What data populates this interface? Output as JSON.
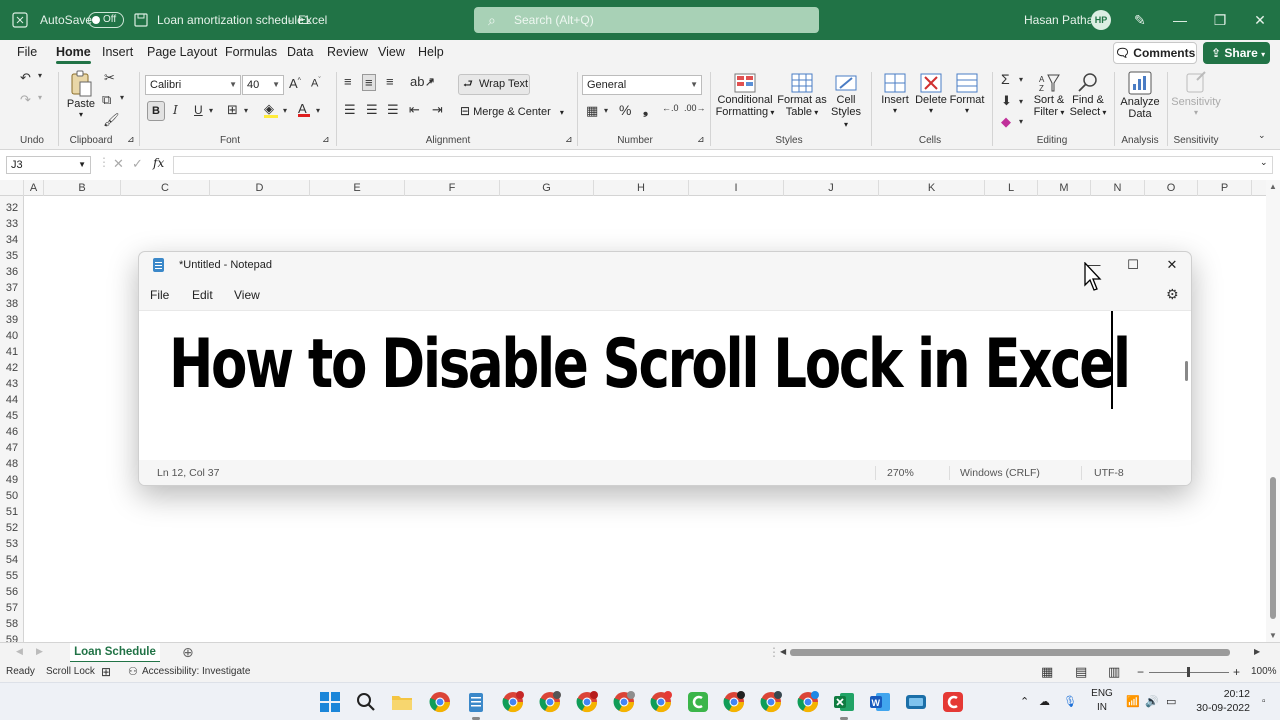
{
  "titlebar": {
    "autosave_label": "AutoSave",
    "autosave_state": "Off",
    "doc_title": "Loan amortization schedule1",
    "app_name": "Excel",
    "search_placeholder": "Search (Alt+Q)",
    "user_name": "Hasan Pathan",
    "user_initials": "HP",
    "accent_color": "#217346"
  },
  "tabs": [
    "File",
    "Home",
    "Insert",
    "Page Layout",
    "Formulas",
    "Data",
    "Review",
    "View",
    "Help"
  ],
  "active_tab": "Home",
  "ribbon_actions": {
    "comments": "Comments",
    "share": "Share"
  },
  "ribbon": {
    "groups": {
      "undo": "Undo",
      "clipboard": "Clipboard",
      "font": "Font",
      "alignment": "Alignment",
      "number": "Number",
      "styles": "Styles",
      "cells": "Cells",
      "editing": "Editing",
      "analysis": "Analysis",
      "sensitivity": "Sensitivity"
    },
    "paste": "Paste",
    "font_name": "Calibri",
    "font_size": "40",
    "bold": "B",
    "italic": "I",
    "underline": "U",
    "wrap_text": "Wrap Text",
    "merge_center": "Merge & Center",
    "number_format": "General",
    "conditional_formatting": [
      "Conditional",
      "Formatting"
    ],
    "format_as_table": [
      "Format as",
      "Table"
    ],
    "cell_styles": [
      "Cell",
      "Styles"
    ],
    "insert": "Insert",
    "delete": "Delete",
    "format": "Format",
    "sort_filter": [
      "Sort &",
      "Filter"
    ],
    "find_select": [
      "Find &",
      "Select"
    ],
    "analyze_data": [
      "Analyze",
      "Data"
    ],
    "sensitivity_btn": "Sensitivity"
  },
  "formula_bar": {
    "name_box": "J3",
    "fx": "fx"
  },
  "columns": [
    "A",
    "B",
    "C",
    "D",
    "E",
    "F",
    "G",
    "H",
    "I",
    "J",
    "K",
    "L",
    "M",
    "N",
    "O",
    "P"
  ],
  "rows": [
    "32",
    "33",
    "34",
    "35",
    "36",
    "37",
    "38",
    "39",
    "40",
    "41",
    "42",
    "43",
    "44",
    "45",
    "46",
    "47",
    "48",
    "49",
    "50",
    "51",
    "52",
    "53",
    "54",
    "55",
    "56",
    "57",
    "58",
    "59"
  ],
  "sheet_tab": "Loan Schedule",
  "status": {
    "ready": "Ready",
    "scroll_lock": "Scroll Lock",
    "accessibility": "Accessibility: Investigate",
    "zoom": "100%"
  },
  "notepad": {
    "title": "*Untitled - Notepad",
    "menu": [
      "File",
      "Edit",
      "View"
    ],
    "content": "How to Disable Scroll Lock in Excel",
    "status_position": "Ln 12, Col 37",
    "status_zoom": "270%",
    "status_eol": "Windows (CRLF)",
    "status_encoding": "UTF-8"
  },
  "taskbar": {
    "lang_top": "ENG",
    "lang_bottom": "IN",
    "time": "20:12",
    "date": "30-09-2022"
  }
}
